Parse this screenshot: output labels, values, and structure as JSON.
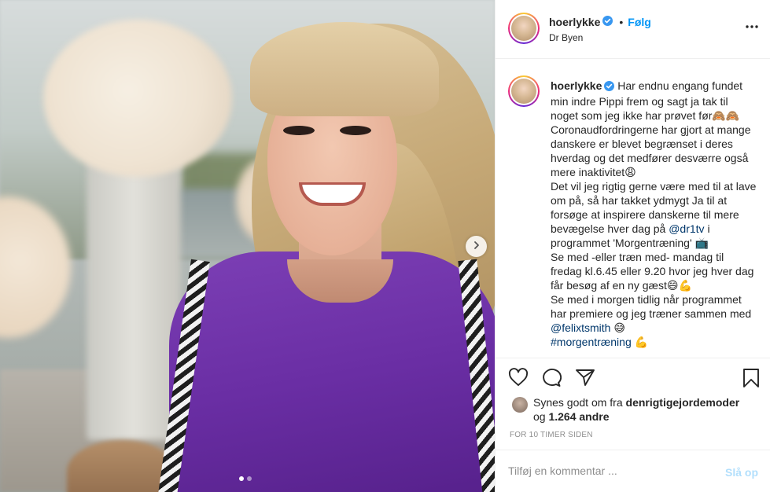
{
  "post": {
    "username": "hoerlykke",
    "follow_label": "Følg",
    "separator": "•",
    "location": "Dr Byen",
    "caption_parts": {
      "p1": "Har endnu engang fundet min indre Pippi frem og sagt ja tak til noget som jeg ikke har prøvet før🙈🙈\nCoronaudfordringerne har gjort at mange danskere er blevet begrænset i deres hverdag og det medfører desværre også mere inaktivitet😩\nDet vil jeg rigtig gerne være med til at lave om på, så har takket ydmygt Ja til at forsøge at inspirere danskerne til mere bevægelse hver dag på ",
      "mention1": "@dr1tv",
      "p2": " i programmet 'Morgentræning' 📺\nSe med -eller træn med- mandag til fredag kl.6.45 eller 9.20 hvor jeg hver dag får besøg af en ny gæst😄💪\nSe med i morgen tidlig når programmet har premiere og jeg træner sammen med ",
      "mention2": "@felixtsmith",
      "p3": " 😅\n",
      "hashtag": "#morgentræning",
      "p4": " 💪"
    },
    "likes": {
      "prefix": "Synes godt om fra ",
      "liker": "denrigtigejordemoder",
      "mid": " og ",
      "count": "1.264 andre"
    },
    "timestamp": "FOR 10 TIMER SIDEN",
    "comment": {
      "placeholder": "Tilføj en kommentar ...",
      "post_label": "Slå op"
    }
  },
  "carousel": {
    "total": 2,
    "active": 0
  },
  "colors": {
    "accent": "#0095f6",
    "mention": "#00376b",
    "text": "#262626",
    "muted": "#8e8e8e"
  },
  "icons": [
    "verified-icon",
    "more-options-icon",
    "heart-icon",
    "comment-icon",
    "share-icon",
    "bookmark-icon",
    "chevron-right-icon"
  ]
}
